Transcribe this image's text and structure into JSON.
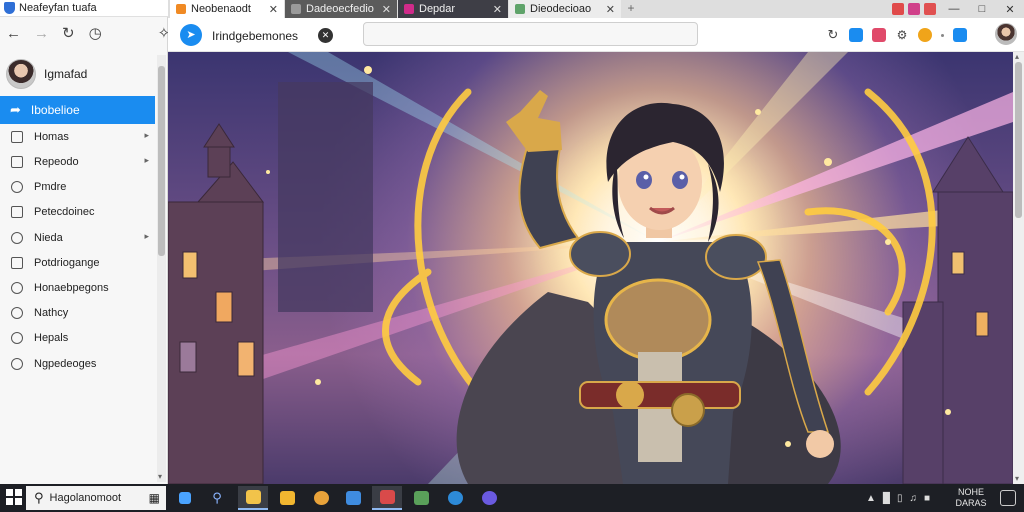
{
  "sidebar": {
    "window_title": "Neafeyfan tuafa",
    "profile_name": "Igmafad",
    "active_item": {
      "label": "Ibobelioe",
      "icon": "pencil-arrow-icon"
    },
    "items": [
      {
        "label": "Homas",
        "icon": "home-icon",
        "chevron": true
      },
      {
        "label": "Repeodo",
        "icon": "folder-icon",
        "chevron": true
      },
      {
        "label": "Pmdre",
        "icon": "tag-icon",
        "chevron": false
      },
      {
        "label": "Petecdoinec",
        "icon": "document-icon",
        "chevron": false
      },
      {
        "label": "Nieda",
        "icon": "media-icon",
        "chevron": true
      },
      {
        "label": "Potdriogange",
        "icon": "image-icon",
        "chevron": false
      },
      {
        "label": "Honaebpegons",
        "icon": "link-icon",
        "chevron": false
      },
      {
        "label": "Nathcy",
        "icon": "compass-icon",
        "chevron": false
      },
      {
        "label": "Hepals",
        "icon": "globe-icon",
        "chevron": false
      },
      {
        "label": "Ngpedeoges",
        "icon": "settings-icon",
        "chevron": false
      }
    ]
  },
  "browser": {
    "tabs": [
      {
        "label": "Neobenaodt",
        "state": "active",
        "favicon_color": "#f08a24"
      },
      {
        "label": "Dadeoecfedio",
        "state": "inactive",
        "favicon_color": "#9a9a9a"
      },
      {
        "label": "Depdar",
        "state": "inactive",
        "favicon_color": "#d02b8a"
      },
      {
        "label": "Dieodecioao",
        "state": "inactive",
        "favicon_color": "#5fa36a"
      }
    ],
    "new_tab_symbol": "+",
    "site_name": "Irindgebemones",
    "address_value": "",
    "extension_colors": [
      "#1a8cf0",
      "#e04a6a",
      "#f0a41a",
      "#1a8cf0"
    ]
  },
  "colors": {
    "accent": "#1a8cf0",
    "taskbar": "#1d1f25"
  },
  "taskbar": {
    "search_text": "Hagolanomoot",
    "apps": [
      {
        "name": "windows-logo",
        "color": "#4aa3ff"
      },
      {
        "name": "search-icon",
        "color": "#8ab4ff"
      },
      {
        "name": "file-explorer-icon",
        "color": "#f2c34a"
      },
      {
        "name": "folder-icon",
        "color": "#f2b630"
      },
      {
        "name": "chrome-icon",
        "color": "#e8a23a"
      },
      {
        "name": "store-icon",
        "color": "#3f8ce0"
      },
      {
        "name": "mail-icon",
        "color": "#d94a4a"
      },
      {
        "name": "notes-icon",
        "color": "#5aa05a"
      },
      {
        "name": "edge-icon",
        "color": "#2d8ad8"
      },
      {
        "name": "assistant-icon",
        "color": "#6a5ae0"
      }
    ],
    "clock_line1": "NOHE",
    "clock_line2": "DARAS"
  }
}
